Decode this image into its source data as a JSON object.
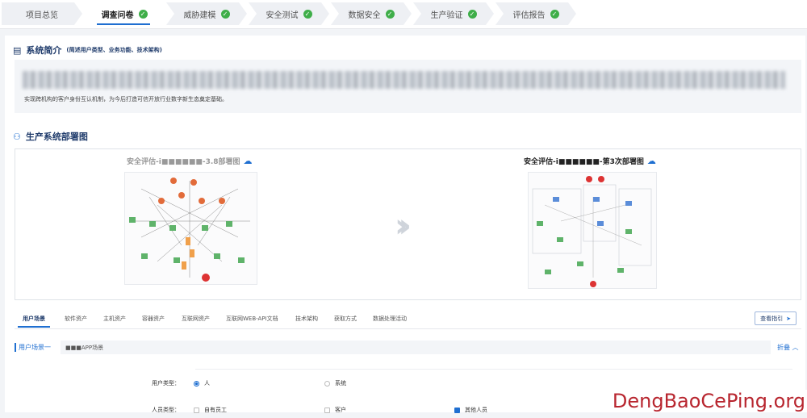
{
  "steps": [
    {
      "label": "项目总览",
      "done": false
    },
    {
      "label": "调查问卷",
      "done": true,
      "active": true
    },
    {
      "label": "威胁建模",
      "done": true
    },
    {
      "label": "安全测试",
      "done": true
    },
    {
      "label": "数据安全",
      "done": true
    },
    {
      "label": "生产验证",
      "done": true
    },
    {
      "label": "评估报告",
      "done": true
    }
  ],
  "intro": {
    "title": "系统简介",
    "subtitle": "(简述用户类型、业务功能、技术架构)",
    "text": "实现跨机构的客户身份互认机制，为今后打造可信开放行业数字新生态奠定基础。"
  },
  "deploy": {
    "title": "生产系统部署图",
    "left_title": "安全评估-i■■■■■■-3.8部署图",
    "right_title": "安全评估-i■■■■■■-第3次部署图"
  },
  "tabs": [
    "用户场景",
    "软件资产",
    "主机资产",
    "容器资产",
    "互联网资产",
    "互联网WEB-API文档",
    "技术架构",
    "获取方式",
    "数据处理活动"
  ],
  "guide_button": "查看指引",
  "scene": {
    "label": "用户场景一",
    "value": "■■■APP场景",
    "collapse": "折叠"
  },
  "user_type": {
    "label": "用户类型：",
    "options": [
      {
        "label": "人",
        "checked": true
      },
      {
        "label": "系统",
        "checked": false
      }
    ]
  },
  "person_type": {
    "label": "人员类型：",
    "options": [
      {
        "label": "自有员工",
        "checked": false
      },
      {
        "label": "客户",
        "checked": false
      },
      {
        "label": "其他人员",
        "checked": true
      }
    ]
  },
  "watermark": "DengBaoCePing.org",
  "colors": {
    "accent": "#1f6fd1",
    "success": "#3fae49",
    "title": "#1f3b6b"
  }
}
